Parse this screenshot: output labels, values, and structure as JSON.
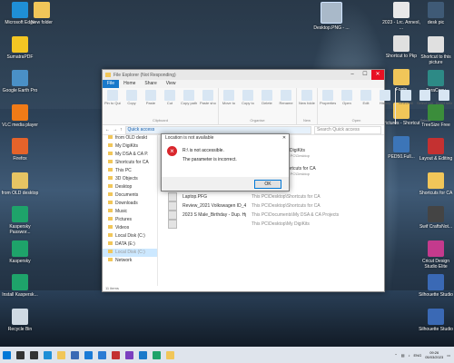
{
  "desktop": {
    "left_icons": [
      {
        "label": "Microsoft Edge",
        "color": "#1f8fd6"
      },
      {
        "label": "SumatraPDF",
        "color": "#f3c623"
      },
      {
        "label": "Google Earth Pro",
        "color": "#4a90c7"
      },
      {
        "label": "VLC media player",
        "color": "#f07b17"
      },
      {
        "label": "Firefox",
        "color": "#e5632a"
      },
      {
        "label": "from OLD desktop",
        "color": "#e6c463"
      },
      {
        "label": "Kaspersky Passwor...",
        "color": "#1ea36a"
      },
      {
        "label": "Kaspersky",
        "color": "#1ea36a"
      },
      {
        "label": "Install Kaspersk...",
        "color": "#1ea36a"
      },
      {
        "label": "Recycle Bin",
        "color": "#cfd9e3"
      }
    ],
    "col2_icons": [
      {
        "label": "New folder",
        "color": "#f1c659"
      }
    ],
    "top_icon": {
      "label": "Desktop.PNG - ...",
      "color": "#a9b9c9"
    },
    "right_icons_col1": [
      {
        "label": "2023 - Lrc. Annexl, ...",
        "color": "#e8e8e8"
      },
      {
        "label": "Shortcut to Pkp",
        "color": "#e0e0e0"
      },
      {
        "label": "Fonts",
        "color": "#f1c659"
      },
      {
        "label": "Pictures - Shortcut",
        "color": "#f1c659"
      },
      {
        "label": "PED50.Full...",
        "color": "#3c75b8"
      }
    ],
    "right_icons_col2": [
      {
        "label": "desk pic",
        "color": "#3f5a76"
      },
      {
        "label": "Shortcut to this picture",
        "color": "#e0e0e0"
      },
      {
        "label": "TeraCopy",
        "color": "#2d8a86"
      },
      {
        "label": "TreeSize Free",
        "color": "#3b8d3b"
      },
      {
        "label": "Layout & Editing",
        "color": "#c43131"
      },
      {
        "label": "Shortcuts for CA",
        "color": "#f1c659"
      },
      {
        "label": "Swif CraftsNot...",
        "color": "#444"
      },
      {
        "label": "Cricut Design Studio Elite",
        "color": "#c43a8d"
      },
      {
        "label": "Silhouette Studio",
        "color": "#3a69b5"
      },
      {
        "label": "Silhouette Studio",
        "color": "#3a69b5"
      }
    ]
  },
  "explorer": {
    "title": "File Explorer (Not Responding)",
    "ribbon_tabs": [
      "File",
      "Home",
      "Share",
      "View"
    ],
    "ribbon_groups": [
      {
        "label": "Clipboard",
        "items": [
          "Pin to Quick access",
          "Copy",
          "Paste",
          "Cut",
          "Copy path",
          "Paste shortcut"
        ]
      },
      {
        "label": "Organise",
        "items": [
          "Move to",
          "Copy to",
          "Delete",
          "Rename"
        ]
      },
      {
        "label": "New",
        "items": [
          "New folder"
        ]
      },
      {
        "label": "Open",
        "items": [
          "Properties",
          "Open",
          "Edit",
          "History"
        ]
      },
      {
        "label": "Select",
        "items": [
          "Select all",
          "Select none",
          "Invert selection"
        ]
      }
    ],
    "address": "Quick access",
    "search_placeholder": "Search Quick access",
    "nav_items": [
      {
        "label": "from OLD deskt",
        "dim": false
      },
      {
        "label": "My DigiKits",
        "dim": false
      },
      {
        "label": "My DSA & CA P.",
        "dim": false
      },
      {
        "label": "Shortcuts for CA",
        "dim": false
      },
      {
        "label": "This PC",
        "dim": false
      },
      {
        "label": "3D Objects",
        "dim": false
      },
      {
        "label": "Desktop",
        "dim": false
      },
      {
        "label": "Documents",
        "dim": false
      },
      {
        "label": "Downloads",
        "dim": false
      },
      {
        "label": "Music",
        "dim": false
      },
      {
        "label": "Pictures",
        "dim": false
      },
      {
        "label": "Videos",
        "dim": false
      },
      {
        "label": "Local Disk (C:)",
        "dim": false
      },
      {
        "label": "DATA (E:)",
        "dim": false
      },
      {
        "label": "Local Disk (C:)",
        "dim": true
      },
      {
        "label": "Network",
        "dim": false
      }
    ],
    "quick_access_items": [
      {
        "name": "from OLD desktop",
        "path": "This PC\\Desktop"
      },
      {
        "name": "My DigiKits",
        "path": "This PC\\Desktop"
      },
      {
        "name": "My DSA & CA Projects",
        "path": "This PC\\Desktop"
      },
      {
        "name": "Shortcuts for CA",
        "path": "This PC\\Desktop"
      }
    ],
    "recent_header": "Recent files (17)",
    "recent_files": [
      {
        "name": "Laptop.PFG",
        "path": "This PC\\Desktop\\Shortcuts for CA"
      },
      {
        "name": "Review_2021 Volkswagen ID_4 is a good match ...",
        "path": "This PC\\Desktop\\Shortcuts for CA"
      },
      {
        "name": "2023 S Male_Birthday - Dup. Hpo Rain_Rain\\Bi...",
        "path": "This PC\\Documents\\My DSA & CA Projects"
      },
      {
        "name": "",
        "path": "This PC\\Desktop\\My DigiKits"
      }
    ],
    "status": "11 items"
  },
  "dialog": {
    "title": "Location is not available",
    "line1": "R:\\ is not accessible.",
    "line2": "The parameter is incorrect.",
    "ok_label": "OK"
  },
  "taskbar": {
    "apps": [
      {
        "name": "windows-start",
        "color": "#0078d7"
      },
      {
        "name": "search",
        "color": "#333"
      },
      {
        "name": "task-view",
        "color": "#333"
      },
      {
        "name": "edge",
        "color": "#1f8fd6"
      },
      {
        "name": "file-explorer",
        "color": "#f1c659"
      },
      {
        "name": "store",
        "color": "#3a69b5"
      },
      {
        "name": "mail",
        "color": "#1a7ad6"
      },
      {
        "name": "photos",
        "color": "#2a7bd4"
      },
      {
        "name": "app-red",
        "color": "#c43131"
      },
      {
        "name": "app-purple",
        "color": "#7b3fbf"
      },
      {
        "name": "app-blue",
        "color": "#1979ca"
      },
      {
        "name": "app-teal",
        "color": "#1ea36a"
      },
      {
        "name": "app-yellow",
        "color": "#f1c659"
      }
    ],
    "time": "09:26",
    "date": "05/03/2023",
    "lang": "ENG"
  }
}
